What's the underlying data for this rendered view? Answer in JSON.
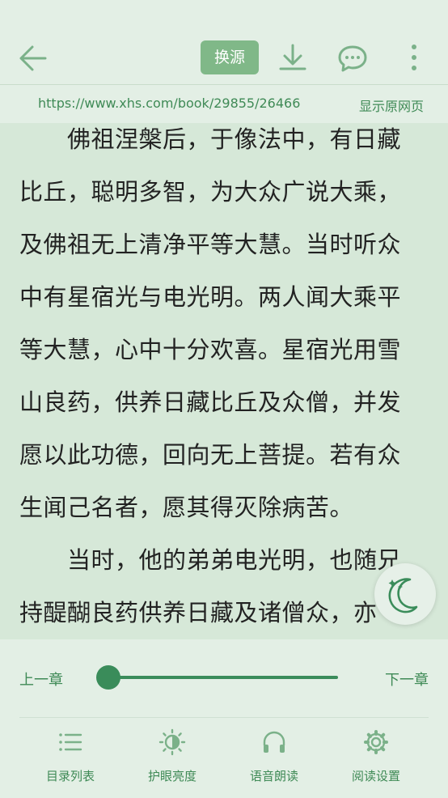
{
  "header": {
    "swap_source_label": "换源",
    "url": "https://www.xhs.com/book/29855/26466",
    "show_original_label": "显示原网页"
  },
  "content": {
    "paragraphs": [
      "　　佛祖涅槃后，于像法中，有日藏比丘，聪明多智，为大众广说大乘，及佛祖无上清净平等大慧。当时听众中有星宿光与电光明。两人闻大乘平等大慧，心中十分欢喜。星宿光用雪山良药，供养日藏比丘及众僧，并发愿以此功德，回向无上菩提。若有众生闻己名者，愿其得灭除病苦。",
      "　　当时，他的弟弟电光明，也随兄持醍醐良药供养日藏及诸僧众，亦"
    ]
  },
  "footer": {
    "prev_chapter": "上一章",
    "next_chapter": "下一章",
    "progress": 0.0,
    "nav": [
      {
        "label": "目录列表",
        "icon": "list-icon"
      },
      {
        "label": "护眼亮度",
        "icon": "brightness-icon"
      },
      {
        "label": "语音朗读",
        "icon": "headphones-icon"
      },
      {
        "label": "阅读设置",
        "icon": "gear-icon"
      }
    ]
  },
  "colors": {
    "accent": "#3a8c5a",
    "background": "#d6e8d8",
    "bar": "#e3efe5",
    "button": "#80b888"
  }
}
